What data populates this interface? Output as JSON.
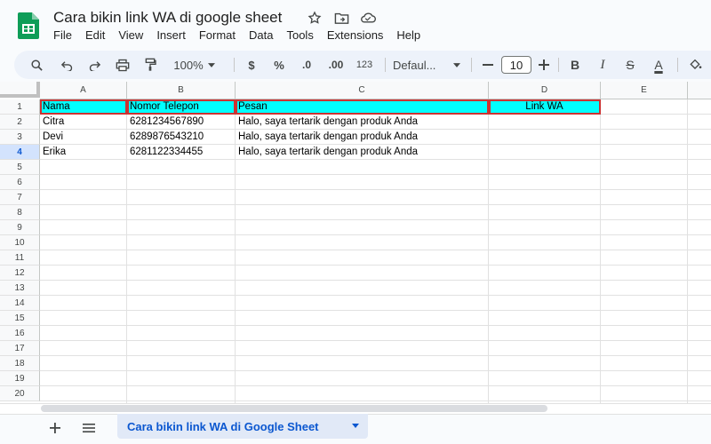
{
  "document": {
    "title": "Cara bikin link WA di google sheet"
  },
  "menu": [
    "File",
    "Edit",
    "View",
    "Insert",
    "Format",
    "Data",
    "Tools",
    "Extensions",
    "Help"
  ],
  "toolbar": {
    "zoom": "100%",
    "currency": "$",
    "percent": "%",
    "decrease_decimal": ".0",
    "increase_decimal": ".00",
    "number_format": "123",
    "font": "Defaul...",
    "font_size": "10",
    "bold": "B",
    "italic": "I",
    "strike": "S",
    "text_color": "A"
  },
  "columns": [
    "A",
    "B",
    "C",
    "D",
    "E"
  ],
  "rows": [
    "1",
    "2",
    "3",
    "4",
    "5",
    "6",
    "7",
    "8",
    "9",
    "10",
    "11",
    "12",
    "13",
    "14",
    "15",
    "16",
    "17",
    "18",
    "19",
    "20"
  ],
  "cells": {
    "header": [
      "Nama",
      "Nomor Telepon",
      "Pesan",
      "Link WA"
    ],
    "data": [
      [
        "Citra",
        "6281234567890",
        "Halo, saya tertarik dengan produk Anda"
      ],
      [
        "Devi",
        "6289876543210",
        "Halo, saya tertarik dengan produk Anda"
      ],
      [
        "Erika",
        "6281122334455",
        "Halo, saya tertarik dengan produk Anda"
      ]
    ]
  },
  "sheet_tab": {
    "label": "Cara bikin link WA di Google Sheet"
  },
  "colors": {
    "header_fill": "#00ffff",
    "header_border": "#cc3333",
    "active_tab": "#0b57d0",
    "logo_green": "#0f9d58"
  },
  "icons": [
    "sheets-logo-icon",
    "star-icon",
    "move-folder-icon",
    "cloud-status-icon",
    "search-icon",
    "undo-icon",
    "redo-icon",
    "print-icon",
    "paint-format-icon",
    "chevron-down-icon",
    "minus-icon",
    "plus-icon",
    "fill-color-icon",
    "add-sheet-icon",
    "all-sheets-icon"
  ]
}
